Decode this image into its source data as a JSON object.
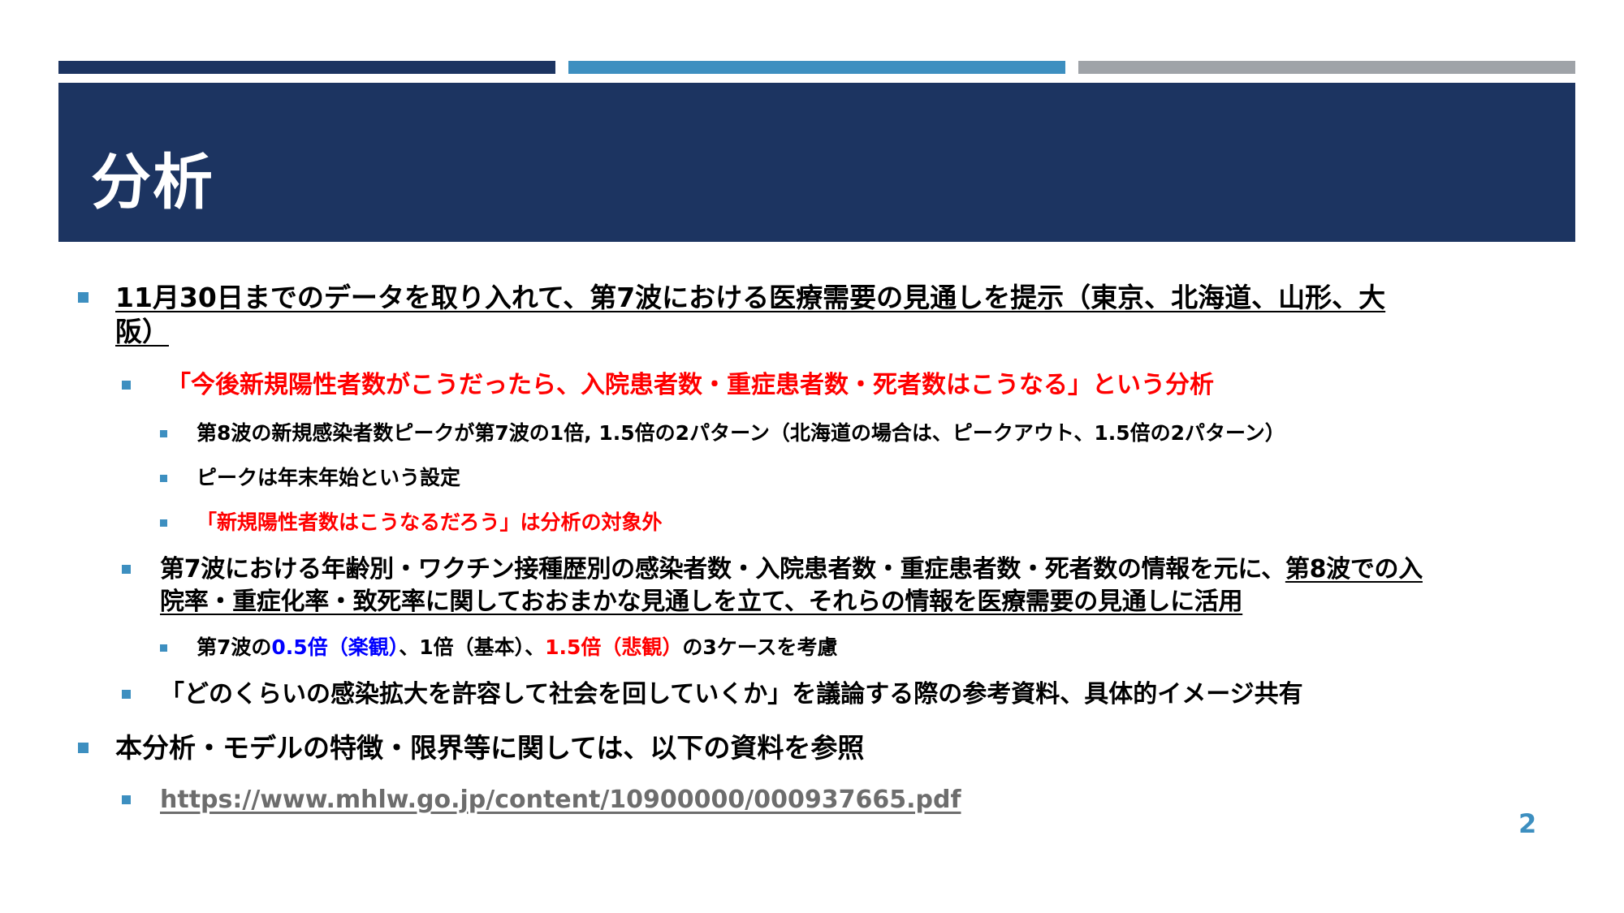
{
  "title": "分析",
  "page_number": "2",
  "bullets": {
    "b1": {
      "text": "11月30日までのデータを取り入れて、第7波における医療需要の見通しを提示（東京、北海道、山形、大",
      "text_cont": "阪）"
    },
    "b2": {
      "text": "「今後新規陽性者数がこうだったら、入院患者数・重症患者数・死者数はこうなる」という分析"
    },
    "b3": {
      "text": "第8波の新規感染者数ピークが第7波の1倍, 1.5倍の2パターン（北海道の場合は、ピークアウト、1.5倍の2パターン）"
    },
    "b4": {
      "text": "ピークは年末年始という設定"
    },
    "b5": {
      "text": "「新規陽性者数はこうなるだろう」は分析の対象外"
    },
    "b6": {
      "text_a": "第7波における年齢別・ワクチン接種歴別の感染者数・入院患者数・重症患者数・死者数の情報を元に、",
      "text_b": "第8波での入",
      "text_cont": "院率・重症化率・致死率に関しておおまかな見通しを立て、それらの情報を医療需要の見通しに活用"
    },
    "b7": {
      "p1": "第7波の",
      "p2": "0.5倍（楽観）",
      "p3": "、1倍（基本）、",
      "p4": "1.5倍（悲観）",
      "p5": "の3ケースを考慮"
    },
    "b8": {
      "text": "「どのくらいの感染拡大を許容して社会を回していくか」を議論する際の参考資料、具体的イメージ共有"
    },
    "b9": {
      "text": "本分析・モデルの特徴・限界等に関しては、以下の資料を参照"
    },
    "b10": {
      "link": "https://www.mhlw.go.jp/content/10900000/000937665.pdf"
    }
  },
  "colors": {
    "navy": "#1c3461",
    "accent_blue": "#3d8fc0",
    "gray": "#9fa3a8",
    "red": "#ff0000",
    "blue": "#0000ff"
  }
}
